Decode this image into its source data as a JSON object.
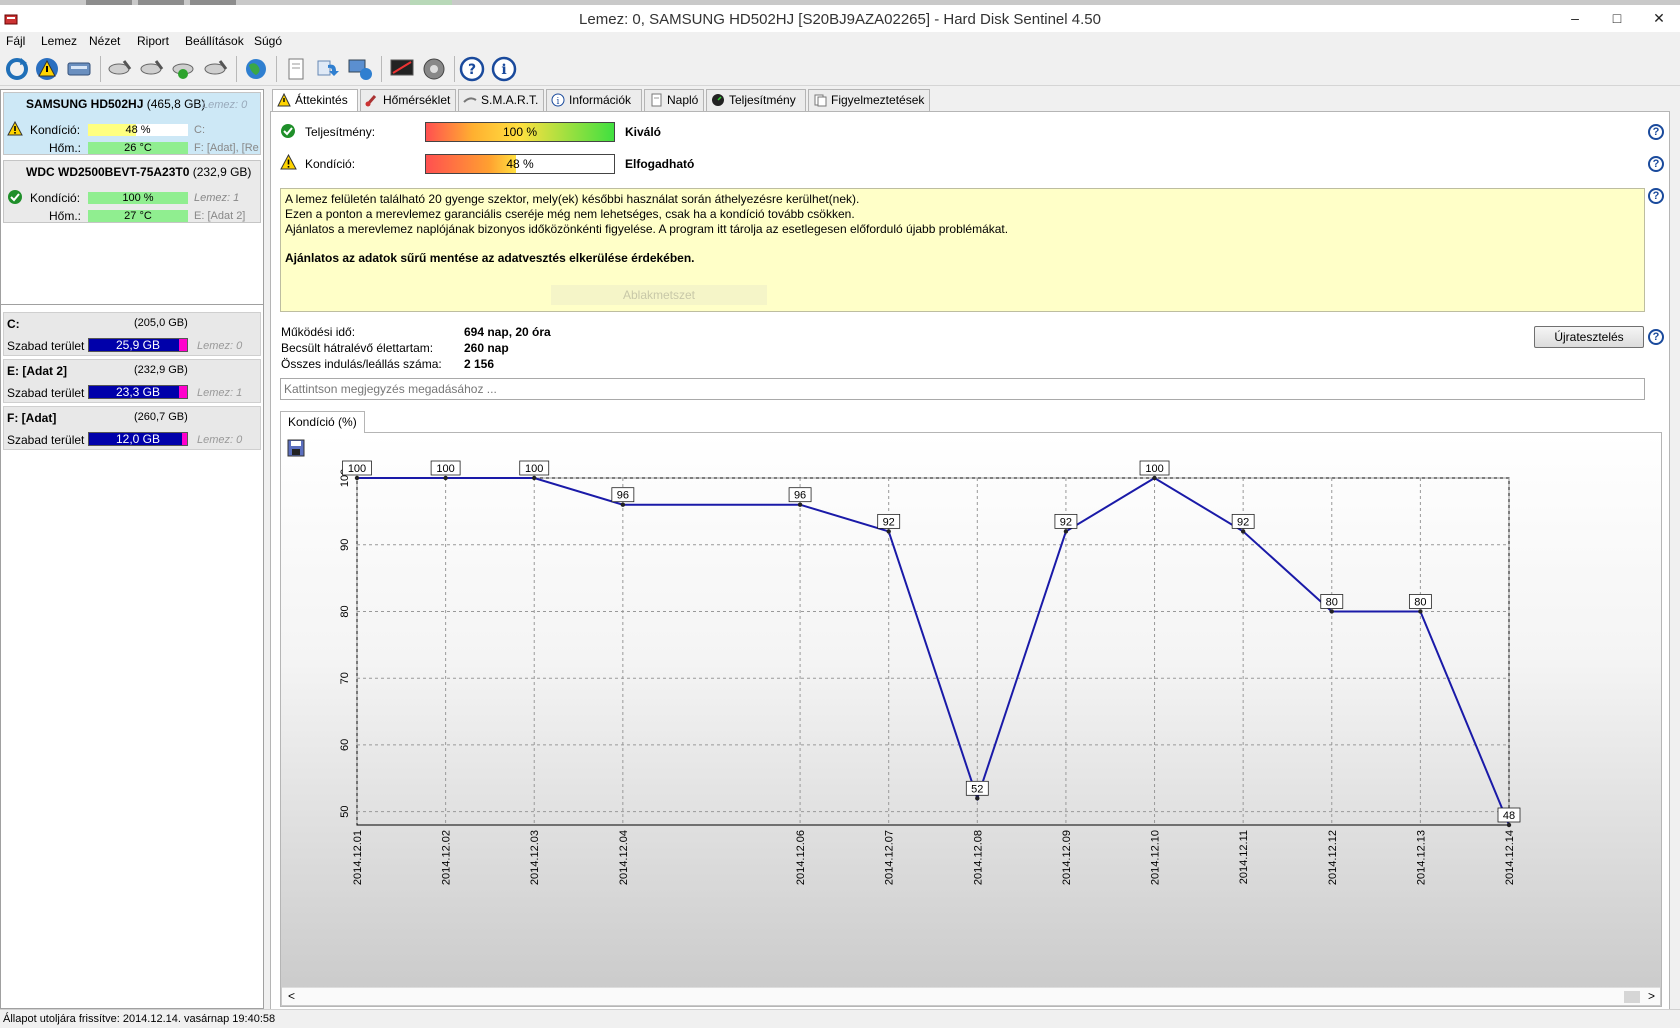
{
  "window": {
    "title": "Lemez: 0, SAMSUNG HD502HJ [S20BJ9AZA02265]  -  Hard Disk Sentinel 4.50",
    "minimize": "–",
    "maximize": "□",
    "close": "✕"
  },
  "menu": [
    "Fájl",
    "Lemez",
    "Nézet",
    "Riport",
    "Beállítások",
    "Súgó"
  ],
  "disks": [
    {
      "name": "SAMSUNG HD502HJ",
      "size": "(465,8 GB)",
      "disk_label": "Lemez: 0",
      "condition_label": "Kondíció:",
      "condition_value": "48 %",
      "condition_pct": 48,
      "temp_label": "Hőm.:",
      "temp_value": "26 °C",
      "vol1": "C:",
      "vol2": "F: [Adat],  [Re",
      "status_icon": "warning-icon",
      "condition_color": "#ffff80"
    },
    {
      "name": "WDC WD2500BEVT-75A23T0",
      "size": "(232,9 GB)",
      "disk_label": "Lemez: 1",
      "condition_label": "Kondíció:",
      "condition_value": "100 %",
      "condition_pct": 100,
      "temp_label": "Hőm.:",
      "temp_value": "27 °C",
      "vol1": "",
      "vol2": "E: [Adat 2]",
      "status_icon": "check-icon",
      "condition_color": "#90ee90"
    }
  ],
  "volumes": [
    {
      "name": "C:",
      "size": "(205,0 GB)",
      "free_label": "Szabad terület",
      "free": "25,9 GB",
      "disk": "Lemez: 0"
    },
    {
      "name": "E: [Adat 2]",
      "size": "(232,9 GB)",
      "free_label": "Szabad terület",
      "free": "23,3 GB",
      "disk": "Lemez: 1"
    },
    {
      "name": "F: [Adat]",
      "size": "(260,7 GB)",
      "free_label": "Szabad terület",
      "free": "12,0 GB",
      "disk": "Lemez: 0"
    }
  ],
  "tabs": [
    "Áttekintés",
    "Hőmérséklet",
    "S.M.A.R.T.",
    "Információk",
    "Napló",
    "Teljesítmény",
    "Figyelmeztetések"
  ],
  "overview": {
    "perf_label": "Teljesítmény:",
    "perf_value": "100 %",
    "perf_pct": 100,
    "perf_rating": "Kiváló",
    "cond_label": "Kondíció:",
    "cond_value": "48 %",
    "cond_pct": 48,
    "cond_rating": "Elfogadható",
    "message_lines": [
      "A lemez felületén található 20 gyenge szektor, mely(ek) későbbi használat során áthelyezésre kerülhet(nek).",
      "Ezen a ponton a merevlemez garanciális cseréje még nem lehetséges, csak ha a kondíció tovább csökken.",
      "Ajánlatos a merevlemez naplójának bizonyos időközönkénti figyelése. A program itt tárolja az esetlegesen előforduló újabb problémákat."
    ],
    "message_bold": "Ajánlatos az adatok sűrű mentése az adatvesztés elkerülése érdekében.",
    "ghost_text": "Ablakmetszet",
    "uptime_label": "Működési idő:",
    "uptime_value": "694 nap, 20 óra",
    "remaining_label": "Becsült hátralévő élettartam:",
    "remaining_value": "260 nap",
    "starts_label": "Összes indulás/leállás száma:",
    "starts_value": "2 156",
    "retest_button": "Újratesztelés",
    "note_placeholder": "Kattintson megjegyzés megadásához ...",
    "chart_tab": "Kondíció  (%)"
  },
  "chart_data": {
    "type": "line",
    "title": "",
    "xlabel": "",
    "ylabel": "",
    "x": [
      "2014.12.01",
      "2014.12.02",
      "2014.12.03",
      "2014.12.04",
      "2014.12.06",
      "2014.12.07",
      "2014.12.08",
      "2014.12.09",
      "2014.12.10",
      "2014.12.11",
      "2014.12.12",
      "2014.12.13",
      "2014.12.14"
    ],
    "y": [
      100,
      100,
      100,
      96,
      96,
      92,
      52,
      92,
      100,
      92,
      80,
      80,
      48
    ],
    "ylim": [
      48,
      100
    ],
    "yticks": [
      50,
      60,
      70,
      80,
      90,
      100
    ],
    "grid": true,
    "line_color": "#1a1aa8"
  },
  "statusbar": {
    "text": "Állapot utoljára frissítve: 2014.12.14. vasárnap 19:40:58"
  },
  "scroll": {
    "left": "<",
    "right": ">"
  }
}
